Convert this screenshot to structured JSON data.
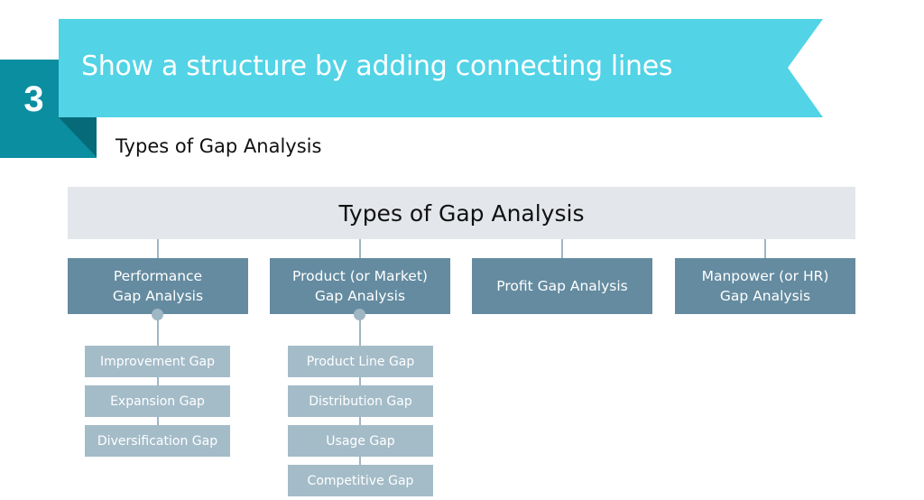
{
  "step_badge": {
    "number": "3"
  },
  "banner": {
    "title": "Show a structure by adding connecting lines"
  },
  "subtitle": "Types of Gap Analysis",
  "colors": {
    "banner": "#52d3e6",
    "badge": "#0a8ea0",
    "badge_fold": "#066a78",
    "root_box": "#e3e6ea",
    "category_box": "#648ba0",
    "sub_box": "#a4bcc8",
    "connector": "#9fb6c3"
  },
  "diagram": {
    "root": "Types of Gap Analysis",
    "categories": [
      {
        "label": "Performance\nGap Analysis",
        "children": [
          "Improvement Gap",
          "Expansion Gap",
          "Diversification Gap"
        ]
      },
      {
        "label": "Product (or Market)\nGap Analysis",
        "children": [
          "Product Line Gap",
          "Distribution Gap",
          "Usage Gap",
          "Competitive Gap"
        ]
      },
      {
        "label": "Profit Gap Analysis",
        "children": []
      },
      {
        "label": "Manpower (or HR)\nGap Analysis",
        "children": []
      }
    ]
  }
}
